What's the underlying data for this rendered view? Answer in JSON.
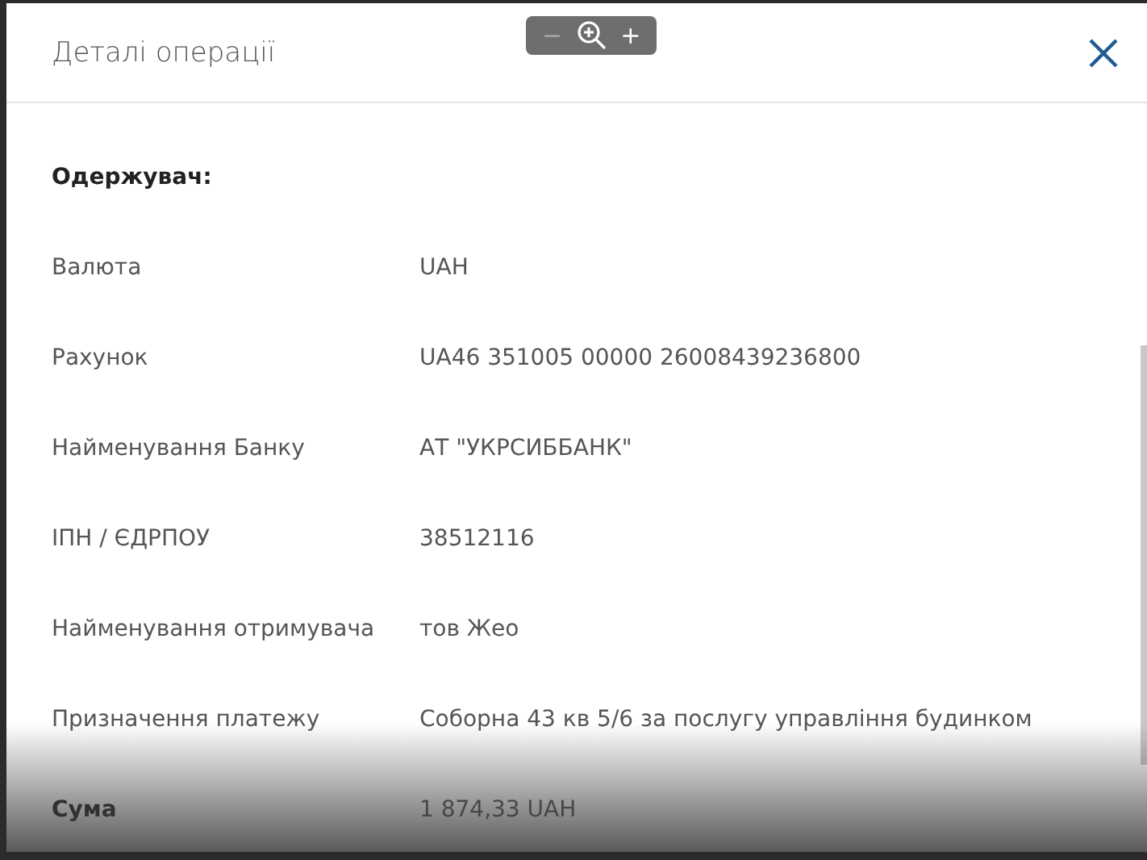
{
  "dialog": {
    "title": "Деталі операції"
  },
  "zoom_toolbar": {
    "zoom_out": {
      "label": "−",
      "disabled": true
    },
    "zoom_in": {
      "label": "+",
      "disabled": false
    }
  },
  "rows": [
    {
      "kind": "heading",
      "label": "Одержувач:"
    },
    {
      "kind": "field",
      "label": "Валюта",
      "value": "UAH"
    },
    {
      "kind": "field",
      "label": "Рахунок",
      "value": "UA46 351005 00000 26008439236800"
    },
    {
      "kind": "field",
      "label": "Найменування Банку",
      "value": "АТ \"УКРСИББАНК\""
    },
    {
      "kind": "field",
      "label": "ІПН / ЄДРПОУ",
      "value": "38512116"
    },
    {
      "kind": "field",
      "label": "Найменування отримувача",
      "value": "тов Жео"
    },
    {
      "kind": "field",
      "label": "Призначення платежу",
      "value": "Соборна 43 кв 5/6 за послугу управління будинком"
    },
    {
      "kind": "total",
      "label": "Сума",
      "value": "1 874,33 UAH"
    }
  ]
}
